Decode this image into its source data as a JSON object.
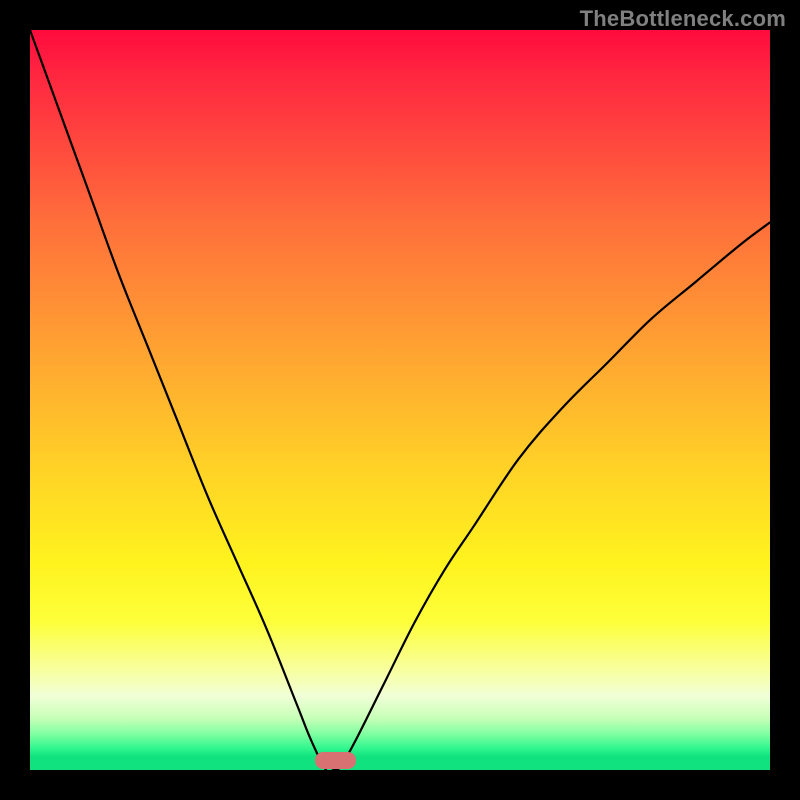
{
  "watermark": "TheBottleneck.com",
  "colors": {
    "top": "#ff0b3d",
    "mid": "#ffd426",
    "bottom": "#0fe27e",
    "curve": "#000000",
    "marker": "#d87272",
    "frame": "#000000"
  },
  "chart_data": {
    "type": "line",
    "title": "",
    "xlabel": "",
    "ylabel": "",
    "xlim": [
      0,
      100
    ],
    "ylim": [
      0,
      100
    ],
    "grid": false,
    "legend": false,
    "x": [
      0,
      4,
      8,
      12,
      16,
      20,
      24,
      28,
      32,
      36,
      38,
      40,
      41,
      42,
      44,
      48,
      52,
      56,
      60,
      66,
      72,
      78,
      84,
      90,
      96,
      100
    ],
    "values": [
      100,
      89,
      78,
      67,
      57,
      47,
      37,
      28,
      19,
      9,
      4,
      0,
      0,
      0.5,
      4,
      12,
      20,
      27,
      33,
      42,
      49,
      55,
      61,
      66,
      71,
      74
    ],
    "marker": {
      "x_start": 38.5,
      "x_end": 44,
      "y": 0.4,
      "height": 2.0
    }
  }
}
